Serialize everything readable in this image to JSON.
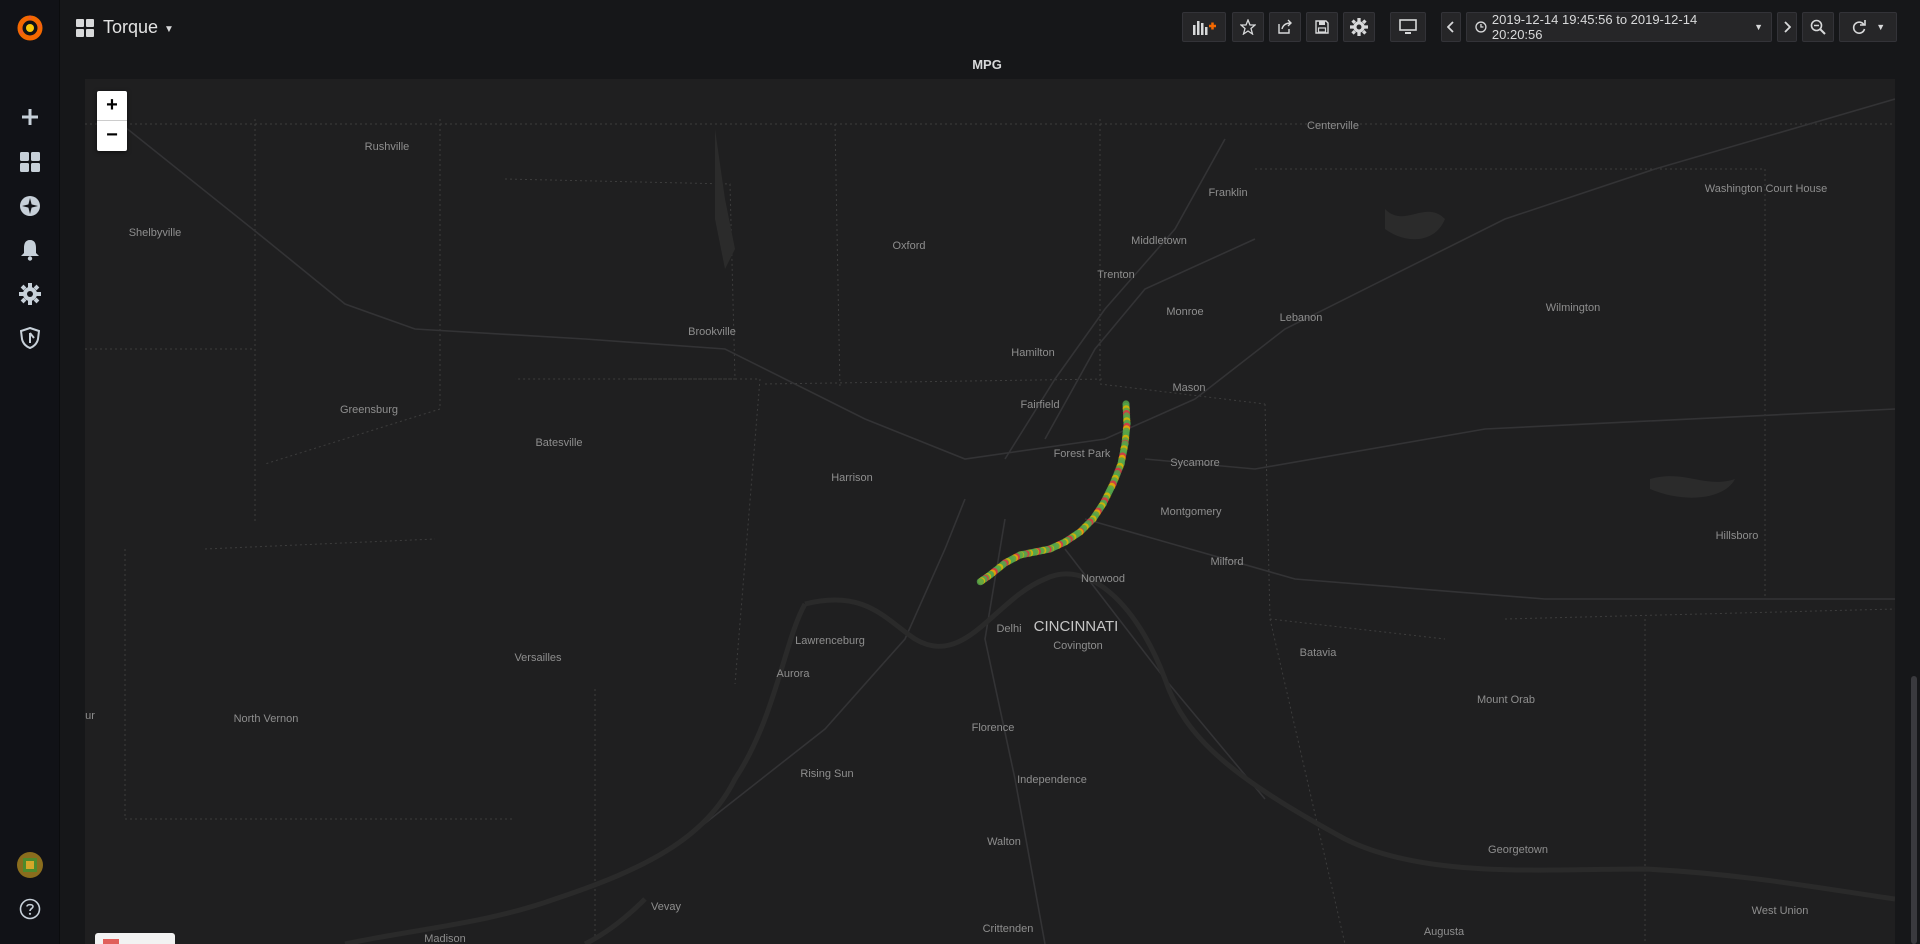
{
  "navbar": {
    "dashboard_title": "Torque",
    "time_range": "2019-12-14 19:45:56 to 2019-12-14 20:20:56"
  },
  "panel": {
    "title": "MPG"
  },
  "map": {
    "zoom_in_label": "+",
    "zoom_out_label": "−",
    "place_labels": [
      "Centerville",
      "Rushville",
      "Franklin",
      "Washington Court House",
      "Shelbyville",
      "Oxford",
      "Middletown",
      "Trenton",
      "Monroe",
      "Lebanon",
      "Wilmington",
      "Brookville",
      "Hamilton",
      "Mason",
      "Greensburg",
      "Fairfield",
      "Batesville",
      "Forest Park",
      "Sycamore",
      "Harrison",
      "Montgomery",
      "Hillsboro",
      "Milford",
      "Norwood",
      "Delhi",
      "CINCINNATI",
      "Covington",
      "Lawrenceburg",
      "Versailles",
      "Batavia",
      "Aurora",
      "Mount Orab",
      "North Vernon",
      "Florence",
      "Rising Sun",
      "Independence",
      "Georgetown",
      "Walton",
      "Crittenden",
      "Augusta",
      "West Union",
      "Madison",
      "Vevay",
      "ur"
    ],
    "track_colors": {
      "good": "#56a64b",
      "mid": "#e0b400",
      "bad": "#e02f44"
    }
  },
  "icons": {
    "logo": "grafana-logo-icon",
    "create": "plus-icon",
    "dashboards": "apps-icon",
    "explore": "compass-icon",
    "alerting": "bell-icon",
    "configuration": "gear-icon",
    "server_admin": "shield-icon",
    "profile": "avatar-icon",
    "help": "question-circle-icon"
  }
}
